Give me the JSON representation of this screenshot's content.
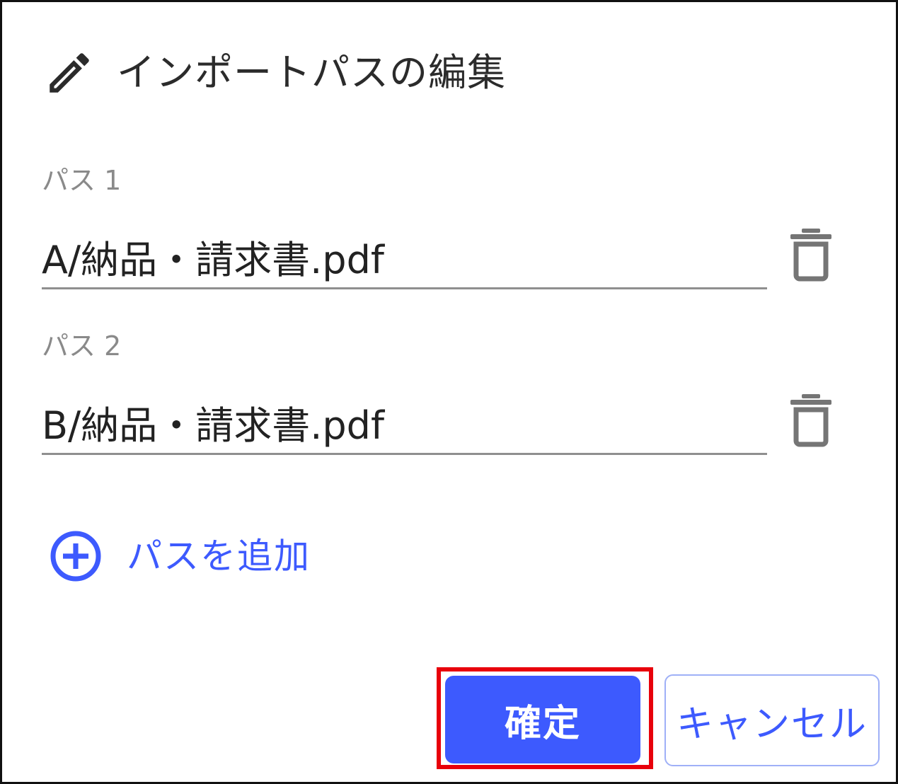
{
  "dialog": {
    "title": "インポートパスの編集",
    "title_icon": "pencil-icon"
  },
  "paths": [
    {
      "label": "パス 1",
      "value": "A/納品・請求書.pdf",
      "delete_icon": "trash-icon"
    },
    {
      "label": "パス 2",
      "value": "B/納品・請求書.pdf",
      "delete_icon": "trash-icon"
    }
  ],
  "add_path": {
    "label": "パスを追加",
    "icon": "add-circle-icon"
  },
  "actions": {
    "confirm_label": "確定",
    "cancel_label": "キャンセル"
  },
  "colors": {
    "accent": "#3d5afe",
    "highlight": "#e8000b",
    "title_text": "#2b2b2b",
    "label_text": "#8a8a8a"
  }
}
